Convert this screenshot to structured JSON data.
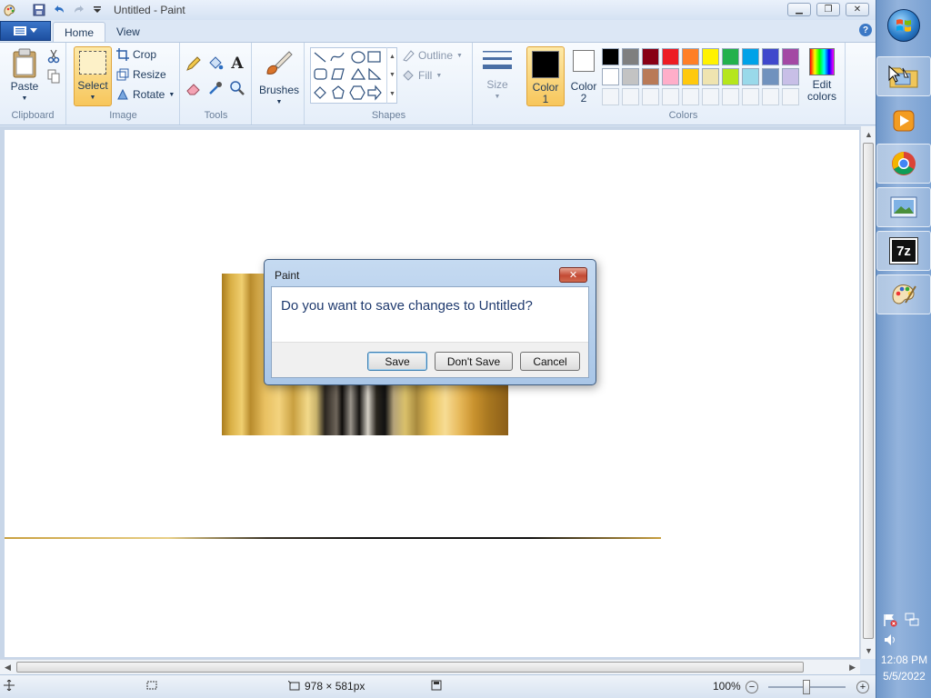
{
  "window": {
    "title": "Untitled - Paint"
  },
  "tabs": {
    "home": "Home",
    "view": "View"
  },
  "clipboard": {
    "paste": "Paste",
    "group_label": "Clipboard"
  },
  "image": {
    "select": "Select",
    "crop": "Crop",
    "resize": "Resize",
    "rotate": "Rotate",
    "group_label": "Image"
  },
  "tools": {
    "group_label": "Tools"
  },
  "brushes": {
    "label": "Brushes"
  },
  "shapes": {
    "outline": "Outline",
    "fill": "Fill",
    "group_label": "Shapes"
  },
  "size": {
    "label": "Size"
  },
  "colors": {
    "color1_line1": "Color",
    "color1_line2": "1",
    "color2_line1": "Color",
    "color2_line2": "2",
    "edit_line1": "Edit",
    "edit_line2": "colors",
    "group_label": "Colors",
    "color1_value": "#000000",
    "color2_value": "#ffffff",
    "palette_row1": [
      "#000000",
      "#7f7f7f",
      "#880015",
      "#ed1c24",
      "#ff7f27",
      "#fff200",
      "#22b14c",
      "#00a2e8",
      "#3f48cc",
      "#a349a4"
    ],
    "palette_row2": [
      "#ffffff",
      "#c3c3c3",
      "#b97a57",
      "#ffaec9",
      "#ffc90e",
      "#efe4b0",
      "#b5e61d",
      "#99d9ea",
      "#7092be",
      "#c8bfe7"
    ]
  },
  "status": {
    "dimensions": "978 × 581px",
    "zoom": "100%"
  },
  "dialog": {
    "title": "Paint",
    "message": "Do you want to save changes to Untitled?",
    "save": "Save",
    "dont_save": "Don't Save",
    "cancel": "Cancel"
  },
  "taskbar": {
    "time": "12:08 PM",
    "date": "5/5/2022",
    "archiver_label": "7z"
  }
}
